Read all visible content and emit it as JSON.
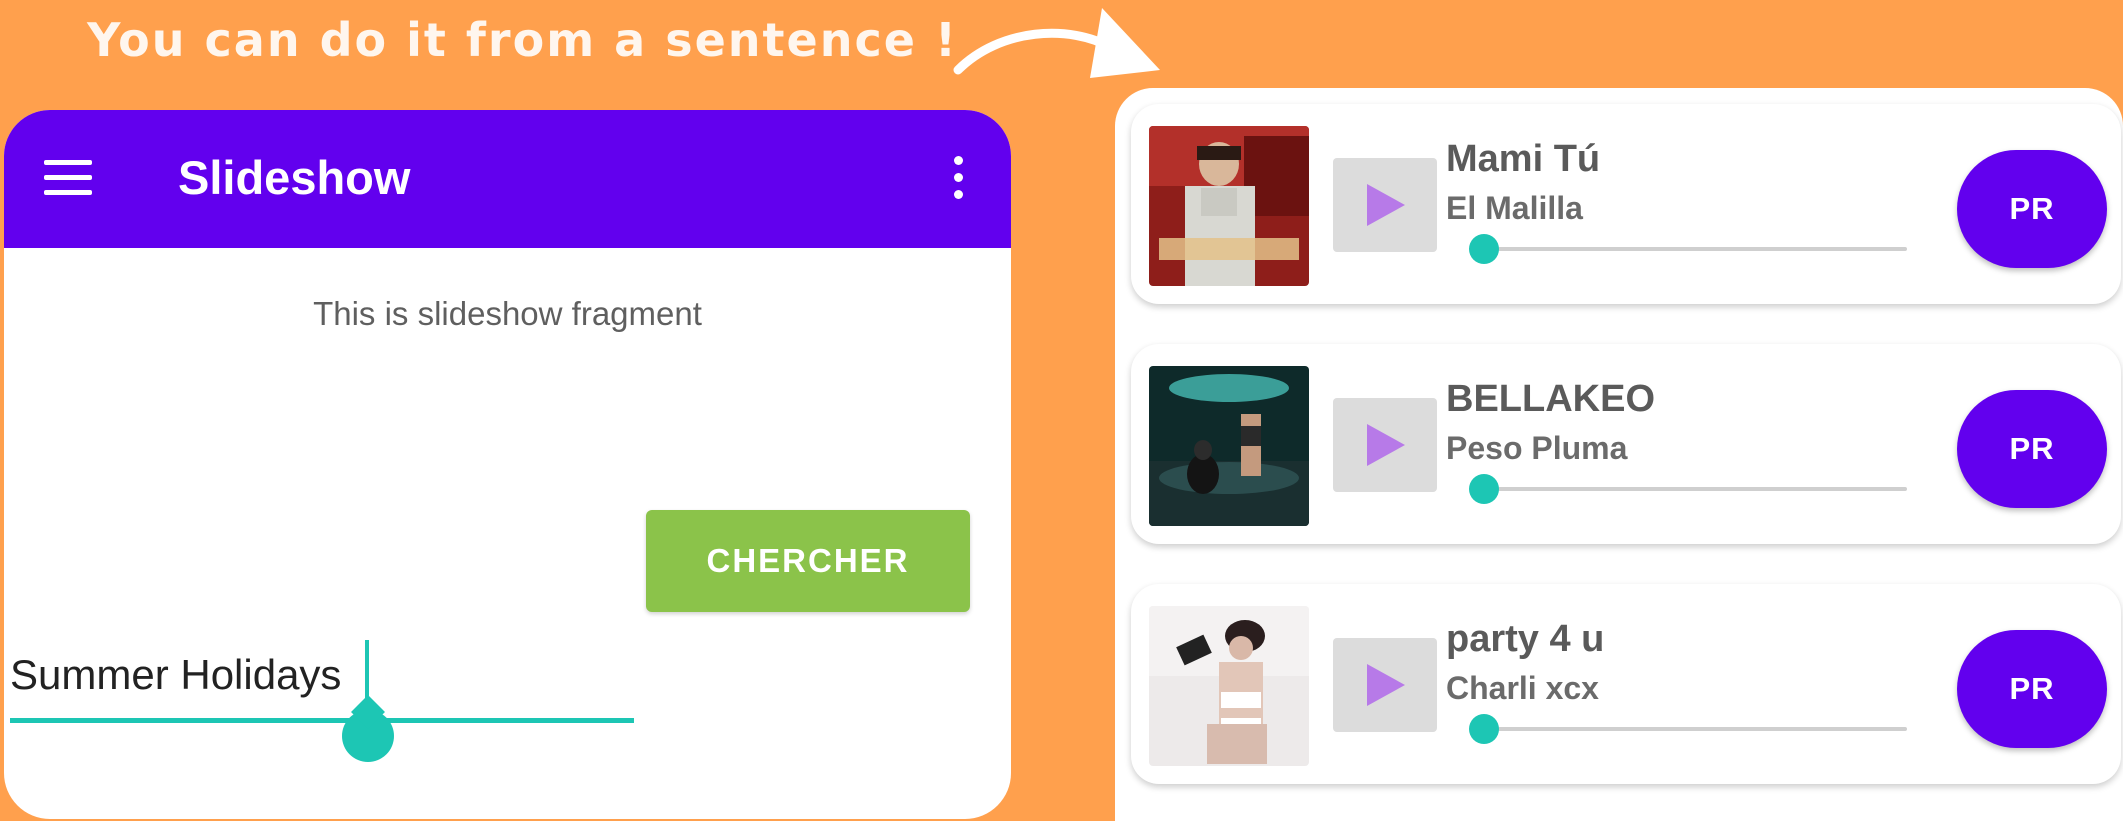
{
  "caption": "You can do it from a sentence !",
  "app": {
    "title": "Slideshow",
    "fragment_text": "This is slideshow fragment",
    "search": {
      "value": "Summer Holidays",
      "button_label": "CHERCHER"
    },
    "ellipsis": "..."
  },
  "tracks": [
    {
      "title": "Mami Tú",
      "artist": "El Malilla",
      "action_label": "PR",
      "progress": 0.0
    },
    {
      "title": "BELLAKEO",
      "artist": "Peso Pluma",
      "action_label": "PR",
      "progress": 0.0
    },
    {
      "title": "party 4 u",
      "artist": "Charli xcx",
      "action_label": "PR",
      "progress": 0.0
    }
  ],
  "icons": {
    "menu": "hamburger-menu-icon",
    "more": "more-vert-icon",
    "play": "play-icon",
    "arrow": "curved-arrow-icon"
  },
  "colors": {
    "background": "#FFA04D",
    "appbar": "#6200EE",
    "accent": "#1DC6B4",
    "search_button": "#8BC34A",
    "play_icon": "#B77AE8",
    "pr_button": "#6200EE"
  }
}
